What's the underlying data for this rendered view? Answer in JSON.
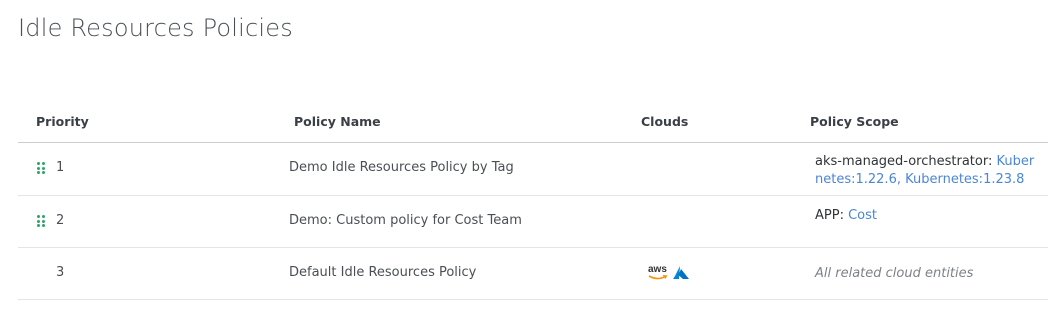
{
  "page": {
    "title": "Idle Resources Policies"
  },
  "table": {
    "headers": {
      "priority": "Priority",
      "policy_name": "Policy Name",
      "clouds": "Clouds",
      "policy_scope": "Policy Scope"
    },
    "rows": [
      {
        "priority": "1",
        "policy_name": "Demo Idle Resources Policy by Tag",
        "draggable": true,
        "clouds": [],
        "scope_key": "aks-managed-orchestrator:",
        "scope_value": "Kubernetes:1.22.6, Kubernetes:1.23.8"
      },
      {
        "priority": "2",
        "policy_name": "Demo: Custom policy for Cost Team",
        "draggable": true,
        "clouds": [],
        "scope_key": "APP:",
        "scope_value": "Cost"
      },
      {
        "priority": "3",
        "policy_name": "Default Idle Resources Policy",
        "draggable": false,
        "clouds": [
          "aws-icon",
          "azure-icon"
        ],
        "scope_text": "All related cloud entities",
        "aws_logo_text": "aws"
      }
    ]
  },
  "colors": {
    "drag_handle": "#2fa36b",
    "link": "#4a86d6",
    "aws_orange": "#f79400",
    "azure_blue": "#0089d6"
  },
  "icons": [
    "drag-handle-icon",
    "aws-icon",
    "azure-icon"
  ]
}
